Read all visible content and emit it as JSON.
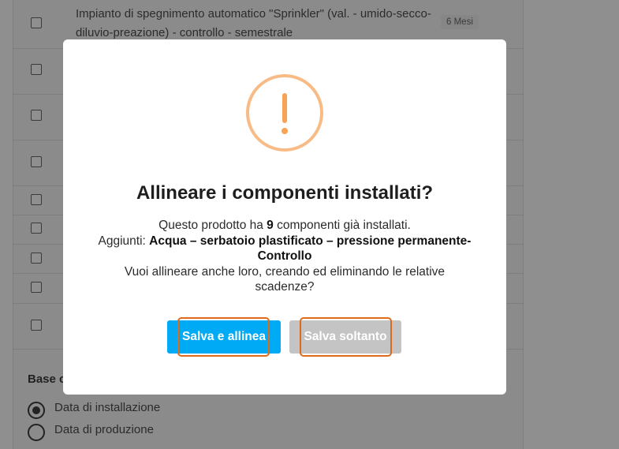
{
  "background": {
    "rows": [
      {
        "text": "Impianto di spegnimento automatico \"Sprinkler\" (val. - umido-secco-diluvio-preazione) - controllo - semestrale",
        "badge": "6 Mesi"
      },
      {
        "text": "",
        "badge": ""
      },
      {
        "text": "",
        "badge": ""
      },
      {
        "text": "",
        "badge": ""
      },
      {
        "text": "",
        "badge": ""
      },
      {
        "text": "",
        "badge": ""
      },
      {
        "text": "",
        "badge": ""
      },
      {
        "text": "",
        "badge": ""
      },
      {
        "text": "",
        "badge": ""
      }
    ],
    "section_title": "Base c",
    "radio_options": [
      {
        "label": "Data di installazione",
        "selected": true
      },
      {
        "label": "Data di produzione",
        "selected": false
      }
    ]
  },
  "dialog": {
    "icon": "warning-exclamation-icon",
    "title": "Allineare i componenti installati?",
    "line1_prefix": "Questo prodotto ha ",
    "line1_count": "9",
    "line1_suffix": " componenti già installati.",
    "line2_prefix": "Aggiunti: ",
    "line2_bold": "Acqua – serbatoio plastificato – pressione permanente-Controllo",
    "line3": "Vuoi allineare anche loro, creando ed eliminando le relative scadenze?",
    "confirm_label": "Salva e allinea",
    "cancel_label": "Salva soltanto"
  },
  "colors": {
    "primary": "#00aaf5",
    "secondary": "#c4c4c4",
    "warning": "#f8bb86",
    "focus": "#e06a1b"
  }
}
